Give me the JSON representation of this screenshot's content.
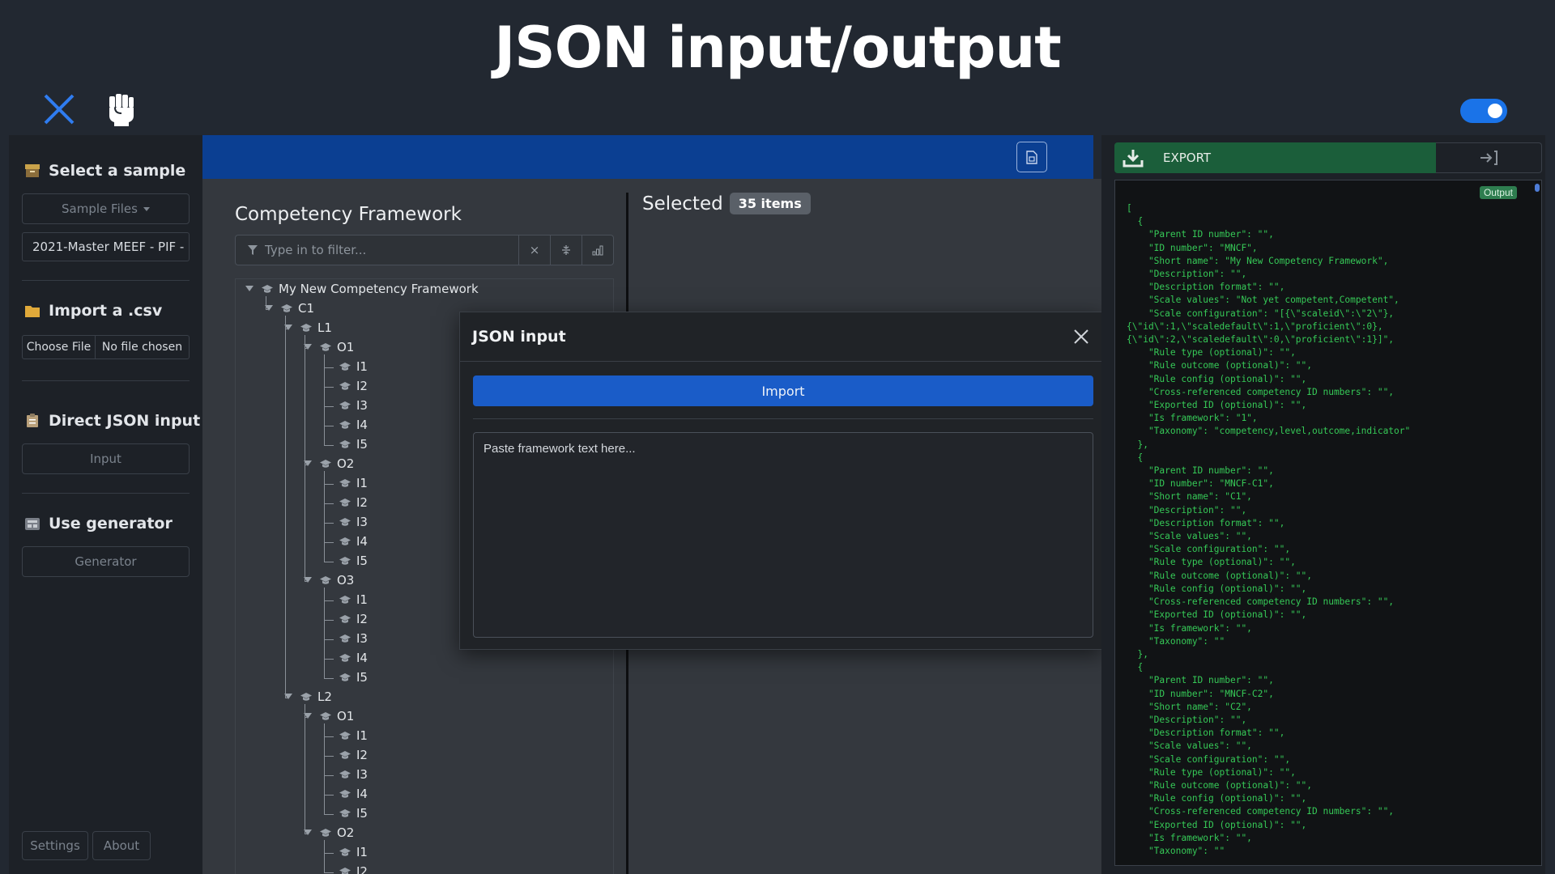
{
  "header": {
    "title": "JSON input/output"
  },
  "sidebar": {
    "sample": {
      "title": "Select a sample",
      "button": "Sample Files",
      "selected": "2021-Master MEEF - PIF - "
    },
    "csv": {
      "title": "Import a .csv",
      "choose": "Choose File",
      "chosen": "No file chosen"
    },
    "json": {
      "title": "Direct JSON input",
      "button": "Input"
    },
    "generator": {
      "title": "Use generator",
      "button": "Generator"
    },
    "settings": "Settings",
    "about": "About"
  },
  "framework": {
    "title": "Competency Framework",
    "filter_placeholder": "Type in to filter...",
    "clear_glyph": "×",
    "tree": {
      "root": "My New Competency Framework",
      "c1": "C1",
      "l1": "L1",
      "l2": "L2",
      "o1": "O1",
      "o2": "O2",
      "o3": "O3",
      "indicators": [
        "I1",
        "I2",
        "I3",
        "I4",
        "I5"
      ]
    }
  },
  "selected": {
    "title": "Selected",
    "count": "35 items"
  },
  "modal": {
    "title": "JSON input",
    "import_button": "Import",
    "textarea_placeholder": "Paste framework text here..."
  },
  "export": {
    "label": "EXPORT",
    "output_tag": "Output"
  },
  "output_json": "[\n  {\n    \"Parent ID number\": \"\",\n    \"ID number\": \"MNCF\",\n    \"Short name\": \"My New Competency Framework\",\n    \"Description\": \"\",\n    \"Description format\": \"\",\n    \"Scale values\": \"Not yet competent,Competent\",\n    \"Scale configuration\": \"[{\\\"scaleid\\\":\\\"2\\\"},\n{\\\"id\\\":1,\\\"scaledefault\\\":1,\\\"proficient\\\":0},\n{\\\"id\\\":2,\\\"scaledefault\\\":0,\\\"proficient\\\":1}]\",\n    \"Rule type (optional)\": \"\",\n    \"Rule outcome (optional)\": \"\",\n    \"Rule config (optional)\": \"\",\n    \"Cross-referenced competency ID numbers\": \"\",\n    \"Exported ID (optional)\": \"\",\n    \"Is framework\": \"1\",\n    \"Taxonomy\": \"competency,level,outcome,indicator\"\n  },\n  {\n    \"Parent ID number\": \"\",\n    \"ID number\": \"MNCF-C1\",\n    \"Short name\": \"C1\",\n    \"Description\": \"\",\n    \"Description format\": \"\",\n    \"Scale values\": \"\",\n    \"Scale configuration\": \"\",\n    \"Rule type (optional)\": \"\",\n    \"Rule outcome (optional)\": \"\",\n    \"Rule config (optional)\": \"\",\n    \"Cross-referenced competency ID numbers\": \"\",\n    \"Exported ID (optional)\": \"\",\n    \"Is framework\": \"\",\n    \"Taxonomy\": \"\"\n  },\n  {\n    \"Parent ID number\": \"\",\n    \"ID number\": \"MNCF-C2\",\n    \"Short name\": \"C2\",\n    \"Description\": \"\",\n    \"Description format\": \"\",\n    \"Scale values\": \"\",\n    \"Scale configuration\": \"\",\n    \"Rule type (optional)\": \"\",\n    \"Rule outcome (optional)\": \"\",\n    \"Rule config (optional)\": \"\",\n    \"Cross-referenced competency ID numbers\": \"\",\n    \"Exported ID (optional)\": \"\",\n    \"Is framework\": \"\",\n    \"Taxonomy\": \"\"",
  "colors": {
    "accent": "#1a5cc8",
    "bluebar": "#0b3f92",
    "export": "#1b5e3a",
    "json_text": "#36c957",
    "toggle": "#1a73e8"
  }
}
